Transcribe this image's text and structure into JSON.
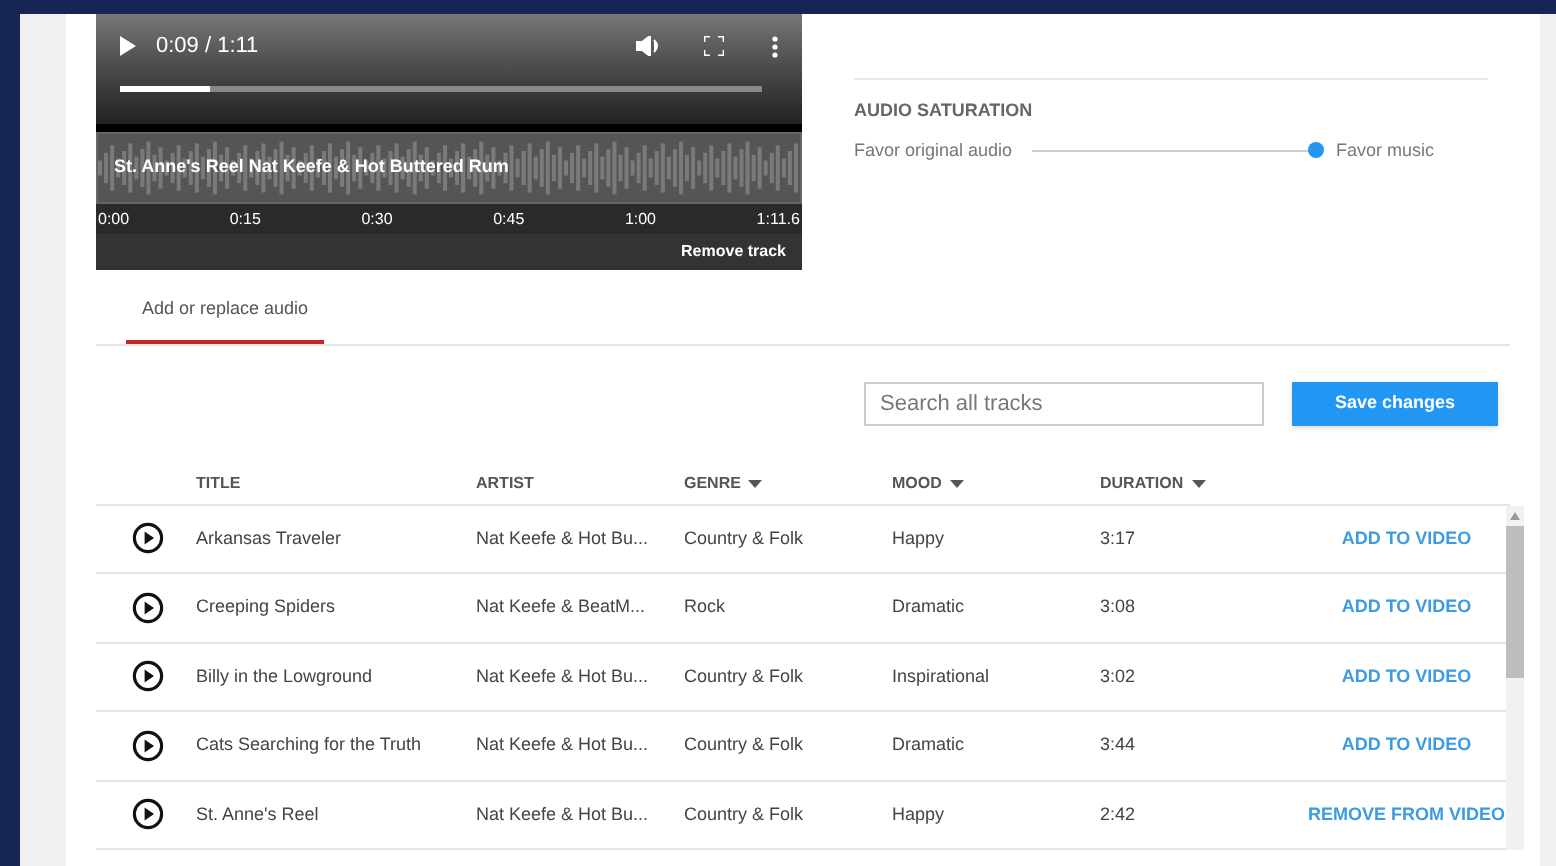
{
  "player": {
    "time": "0:09 / 1:11",
    "progress": {
      "level": 0.14
    },
    "track_label": "St. Anne's Reel Nat Keefe & Hot Buttered Rum",
    "timeline_ticks": [
      "0:00",
      "0:15",
      "0:30",
      "0:45",
      "1:00",
      "1:11.6"
    ],
    "remove_button": "Remove track"
  },
  "audio_saturation": {
    "heading": "AUDIO SATURATION",
    "left_label": "Favor original audio",
    "right_label": "Favor music",
    "level": 1.0
  },
  "tabs": [
    {
      "label": "Add or replace audio",
      "selected": true
    }
  ],
  "search": {
    "placeholder": "Search all tracks"
  },
  "save_button": "Save changes",
  "table": {
    "columns": [
      {
        "label": "TITLE",
        "sortable": false
      },
      {
        "label": "ARTIST",
        "sortable": false
      },
      {
        "label": "GENRE",
        "sortable": true
      },
      {
        "label": "MOOD",
        "sortable": true
      },
      {
        "label": "DURATION",
        "sortable": true
      }
    ],
    "rows": [
      {
        "title": "Arkansas Traveler",
        "artist": "Nat Keefe & Hot Bu...",
        "genre": "Country & Folk",
        "mood": "Happy",
        "duration": "3:17",
        "action": "ADD TO VIDEO"
      },
      {
        "title": "Creeping Spiders",
        "artist": "Nat Keefe & BeatM...",
        "genre": "Rock",
        "mood": "Dramatic",
        "duration": "3:08",
        "action": "ADD TO VIDEO"
      },
      {
        "title": "Billy in the Lowground",
        "artist": "Nat Keefe & Hot Bu...",
        "genre": "Country & Folk",
        "mood": "Inspirational",
        "duration": "3:02",
        "action": "ADD TO VIDEO"
      },
      {
        "title": "Cats Searching for the Truth",
        "artist": "Nat Keefe & Hot Bu...",
        "genre": "Country & Folk",
        "mood": "Dramatic",
        "duration": "3:44",
        "action": "ADD TO VIDEO"
      },
      {
        "title": "St. Anne's Reel",
        "artist": "Nat Keefe & Hot Bu...",
        "genre": "Country & Folk",
        "mood": "Happy",
        "duration": "2:42",
        "action": "REMOVE FROM VIDEO"
      }
    ]
  }
}
